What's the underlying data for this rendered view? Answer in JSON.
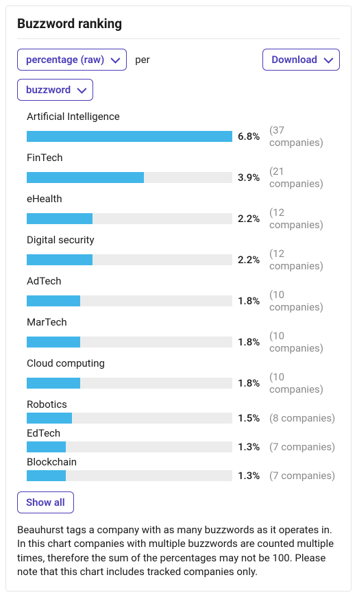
{
  "title": "Buzzword ranking",
  "controls": {
    "metric_label": "percentage (raw)",
    "per_label": "per",
    "download_label": "Download",
    "dimension_label": "buzzword",
    "showall_label": "Show all"
  },
  "footnote": "Beauhurst tags a company with as many buzzwords as it operates in. In this chart companies with multiple buzzwords are counted multiple times, therefore the sum of the percentages may not be 100. Please note that this chart includes tracked companies only.",
  "chart_data": {
    "type": "bar",
    "title": "Buzzword ranking",
    "xlabel": "percentage (raw)",
    "ylabel": "buzzword",
    "categories": [
      "Artificial Intelligence",
      "FinTech",
      "eHealth",
      "Digital security",
      "AdTech",
      "MarTech",
      "Cloud computing",
      "Robotics",
      "EdTech",
      "Blockchain"
    ],
    "values": [
      6.8,
      3.9,
      2.2,
      2.2,
      1.8,
      1.8,
      1.8,
      1.5,
      1.3,
      1.3
    ],
    "series": [
      {
        "name": "percentage",
        "values": [
          6.8,
          3.9,
          2.2,
          2.2,
          1.8,
          1.8,
          1.8,
          1.5,
          1.3,
          1.3
        ]
      },
      {
        "name": "company_count",
        "values": [
          37,
          21,
          12,
          12,
          10,
          10,
          10,
          8,
          7,
          7
        ]
      }
    ],
    "x_range": [
      0,
      6.8
    ]
  },
  "rows": [
    {
      "label": "Artificial Intelligence",
      "pct": "6.8%",
      "count": "(37 companies)",
      "fill": 100
    },
    {
      "label": "FinTech",
      "pct": "3.9%",
      "count": "(21 companies)",
      "fill": 57
    },
    {
      "label": "eHealth",
      "pct": "2.2%",
      "count": "(12 companies)",
      "fill": 32
    },
    {
      "label": "Digital security",
      "pct": "2.2%",
      "count": "(12 companies)",
      "fill": 32
    },
    {
      "label": "AdTech",
      "pct": "1.8%",
      "count": "(10 companies)",
      "fill": 26
    },
    {
      "label": "MarTech",
      "pct": "1.8%",
      "count": "(10 companies)",
      "fill": 26
    },
    {
      "label": "Cloud computing",
      "pct": "1.8%",
      "count": "(10 companies)",
      "fill": 26
    },
    {
      "label": "Robotics",
      "pct": "1.5%",
      "count": "(8 companies)",
      "fill": 22
    },
    {
      "label": "EdTech",
      "pct": "1.3%",
      "count": "(7 companies)",
      "fill": 19
    },
    {
      "label": "Blockchain",
      "pct": "1.3%",
      "count": "(7 companies)",
      "fill": 19
    }
  ]
}
